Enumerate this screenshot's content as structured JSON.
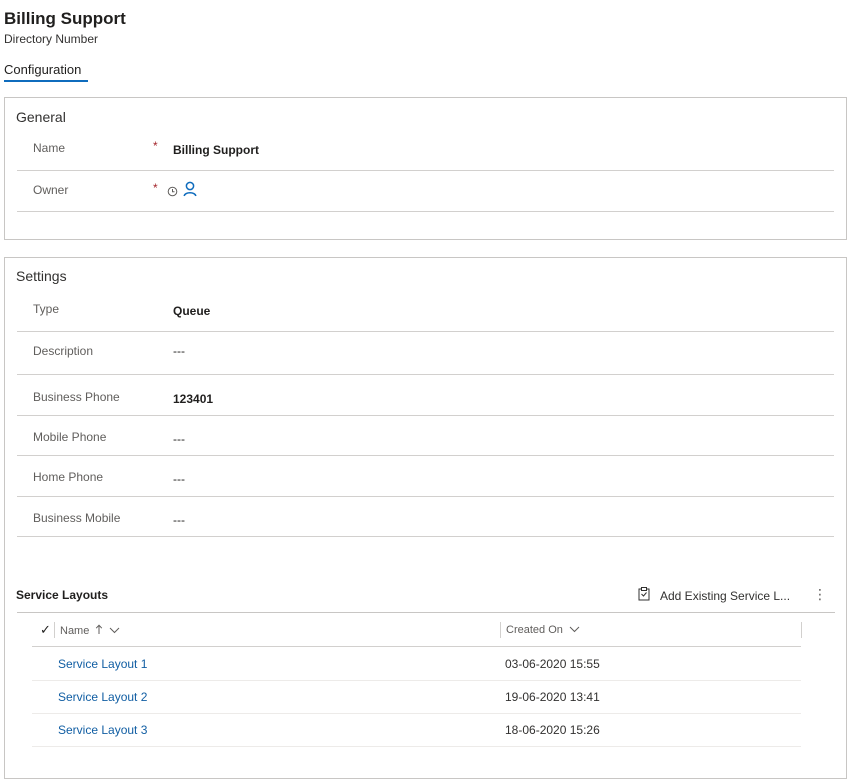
{
  "header": {
    "title": "Billing Support",
    "subtitle": "Directory Number"
  },
  "tabs": [
    {
      "label": "Configuration",
      "active": true
    }
  ],
  "general": {
    "title": "General",
    "fields": {
      "name": {
        "label": "Name",
        "value": "Billing Support",
        "required": "*"
      },
      "owner": {
        "label": "Owner",
        "required": "*",
        "icons": [
          "clock-icon",
          "user-icon"
        ]
      }
    }
  },
  "settings": {
    "title": "Settings",
    "fields": [
      {
        "label": "Type",
        "value": "Queue"
      },
      {
        "label": "Description",
        "value": "---"
      },
      {
        "label": "Business Phone",
        "value": "123401"
      },
      {
        "label": "Mobile Phone",
        "value": "---"
      },
      {
        "label": "Home Phone",
        "value": "---"
      },
      {
        "label": "Business Mobile",
        "value": "---"
      }
    ]
  },
  "service_layouts": {
    "title": "Service Layouts",
    "add_action": "Add Existing Service L...",
    "columns": {
      "name": "Name",
      "created_on": "Created On"
    },
    "rows": [
      {
        "name": "Service Layout 1",
        "created_on": "03-06-2020 15:55"
      },
      {
        "name": "Service Layout 2",
        "created_on": "19-06-2020 13:41"
      },
      {
        "name": "Service Layout 3",
        "created_on": "18-06-2020 15:26"
      }
    ]
  },
  "colors": {
    "accent": "#0f6cbd",
    "link": "#115ea3",
    "required": "#a4262c"
  }
}
